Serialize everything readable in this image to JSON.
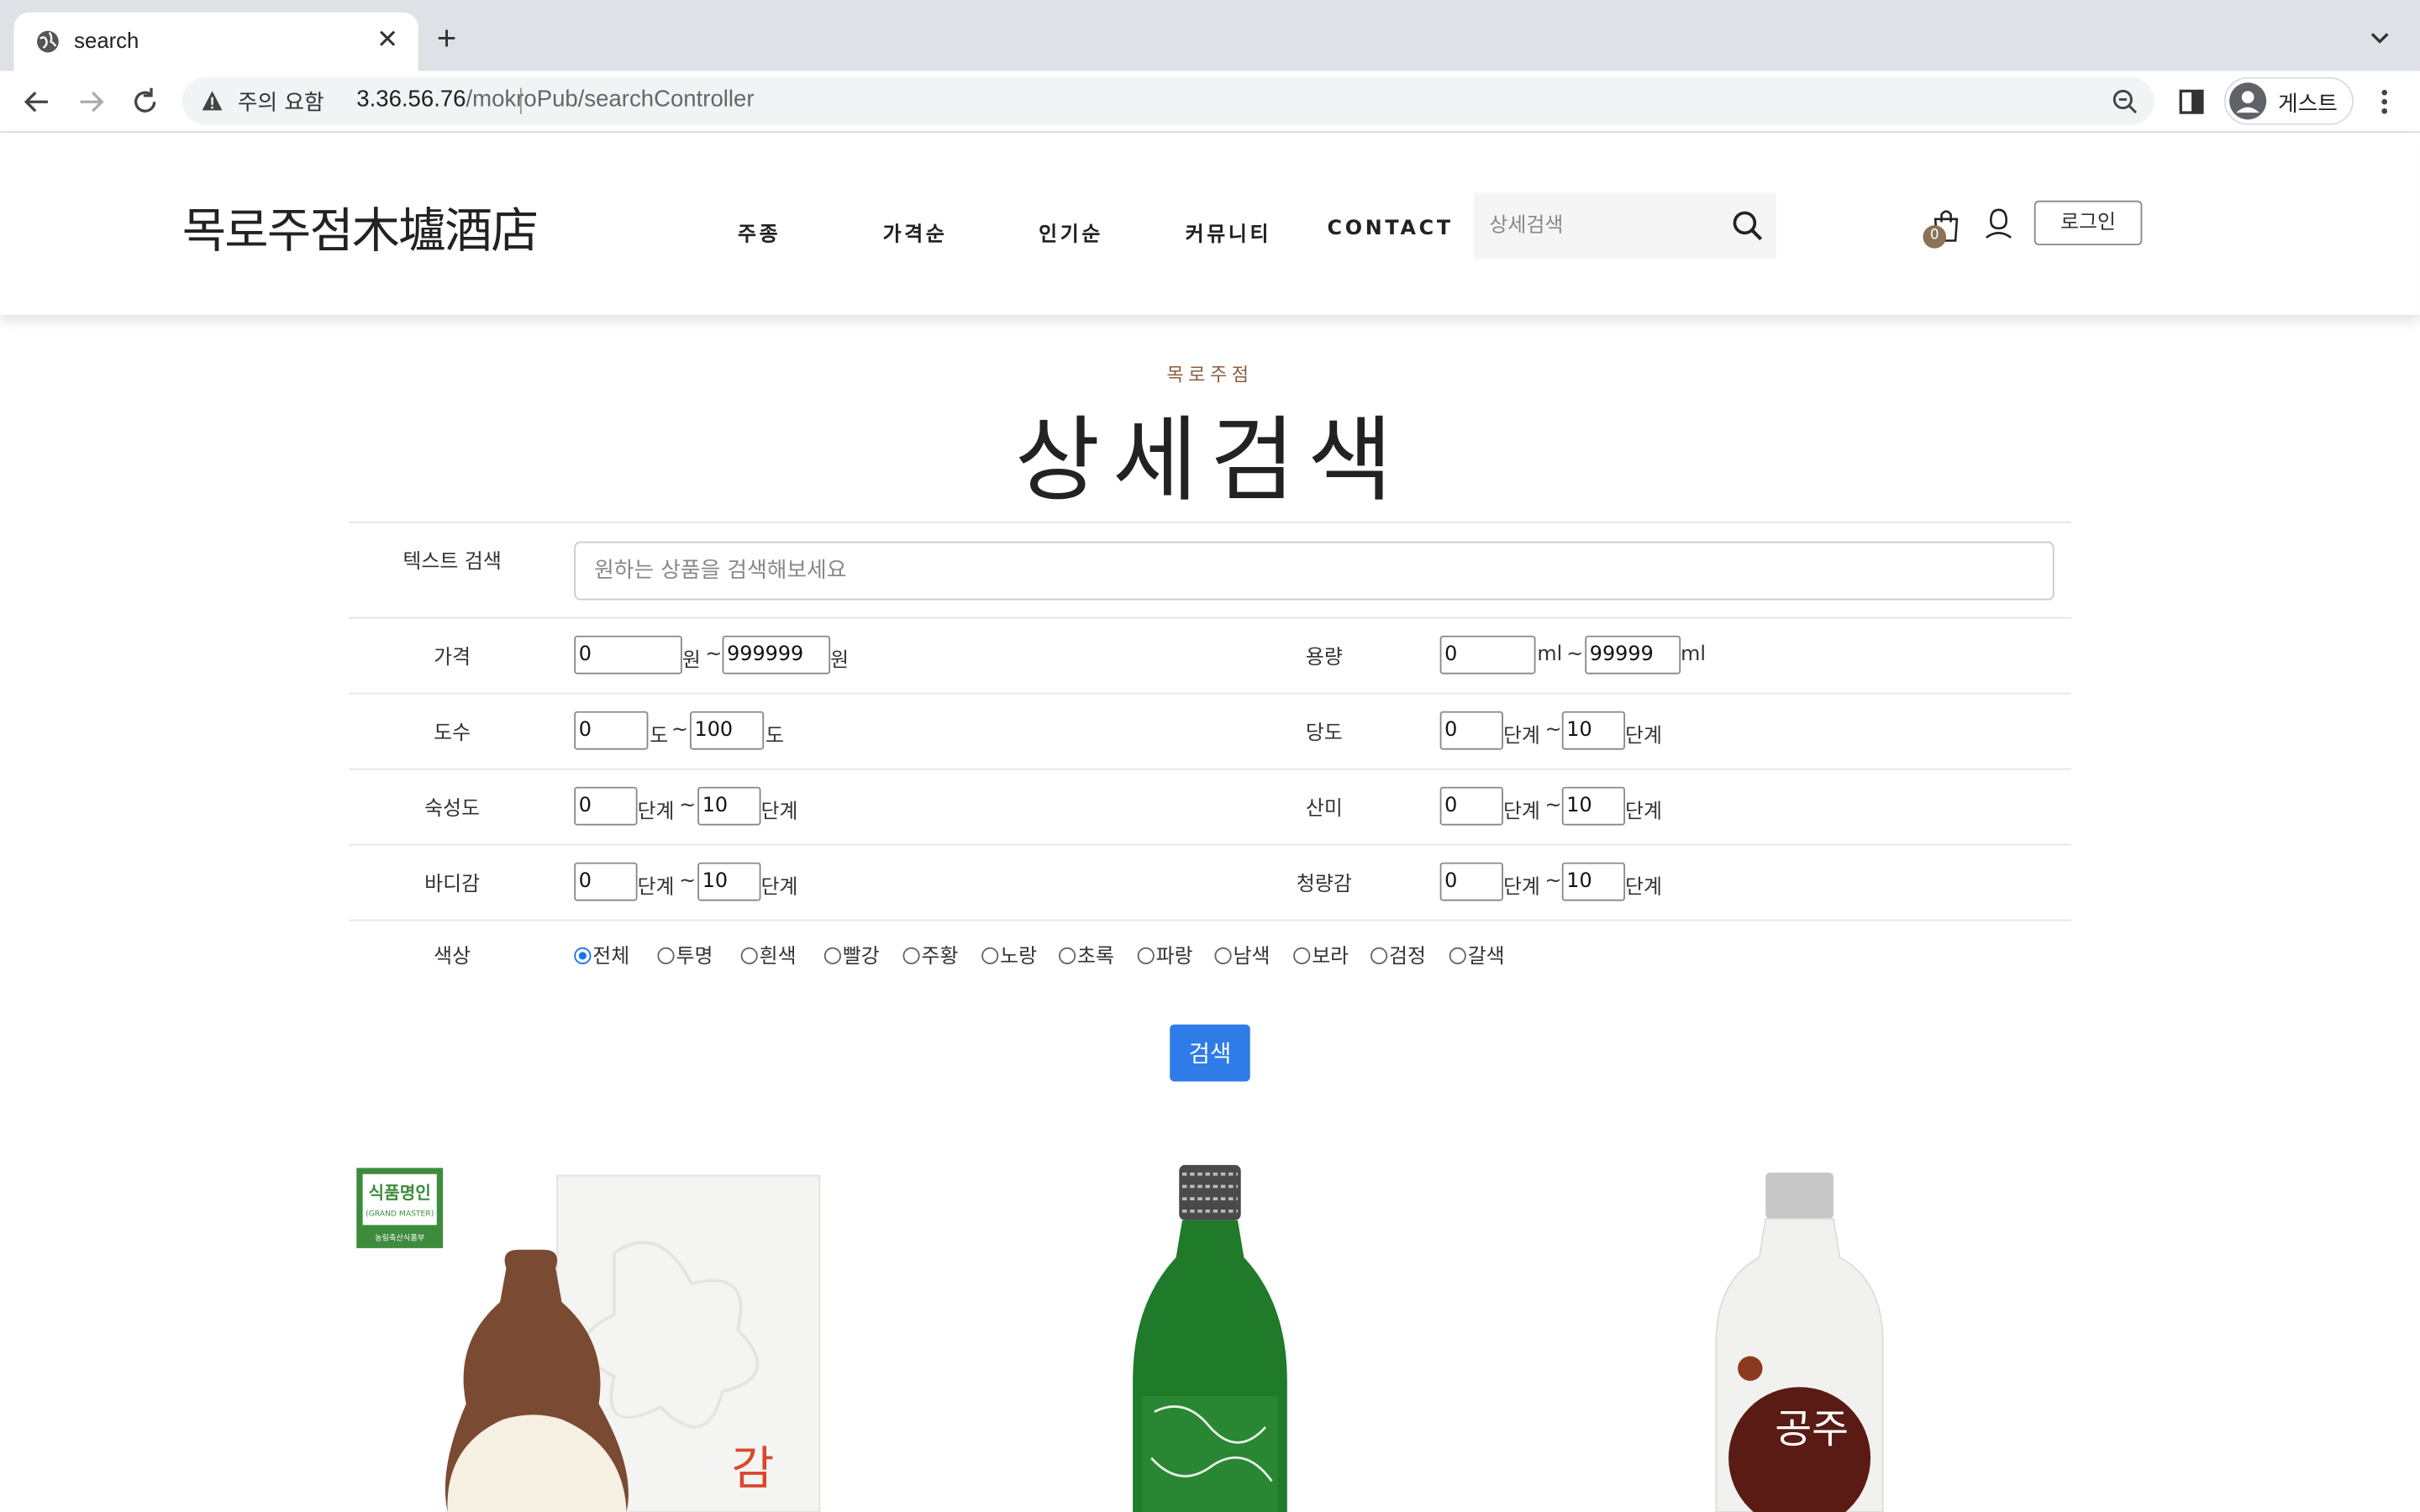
{
  "browser": {
    "tab_title": "search",
    "warning_text": "주의 요함",
    "url_host": "3.36.56.76",
    "url_path": "/mokroPub/searchController",
    "profile_name": "게스트"
  },
  "header": {
    "logo": "목로주점木壚酒店",
    "nav": [
      "주종",
      "가격순",
      "인기순",
      "커뮤니티",
      "CONTACT"
    ],
    "search_placeholder": "상세검색",
    "cart_count": "0",
    "login_label": "로그인"
  },
  "page": {
    "subtitle": "목로주점",
    "title": "상세검색"
  },
  "form": {
    "text_search": {
      "label": "텍스트 검색",
      "placeholder": "원하는 상품을 검색해보세요"
    },
    "price": {
      "label": "가격",
      "min": "0",
      "max": "999999",
      "unit": "원",
      "sep": "~"
    },
    "volume": {
      "label": "용량",
      "min": "0",
      "max": "99999",
      "unit": "ml",
      "sep": "~"
    },
    "abv": {
      "label": "도수",
      "min": "0",
      "max": "100",
      "unit": "도",
      "sep": "~"
    },
    "sweetness": {
      "label": "당도",
      "min": "0",
      "max": "10",
      "unit": "단계",
      "sep": "~"
    },
    "aging": {
      "label": "숙성도",
      "min": "0",
      "max": "10",
      "unit": "단계",
      "sep": "~"
    },
    "acidity": {
      "label": "산미",
      "min": "0",
      "max": "10",
      "unit": "단계",
      "sep": "~"
    },
    "body": {
      "label": "바디감",
      "min": "0",
      "max": "10",
      "unit": "단계",
      "sep": "~"
    },
    "freshness": {
      "label": "청량감",
      "min": "0",
      "max": "10",
      "unit": "단계",
      "sep": "~"
    },
    "color": {
      "label": "색상",
      "options": [
        "전체",
        "투명",
        "흰색",
        "빨강",
        "주황",
        "노랑",
        "초록",
        "파랑",
        "남색",
        "보라",
        "검정",
        "갈색"
      ],
      "selected": "전체"
    },
    "submit_label": "검색"
  },
  "products": {
    "p1": {
      "badge_title": "식품명인",
      "badge_sub": "(GRAND MASTER)",
      "badge_ministry": "농림축산식품부",
      "box_text": "감"
    },
    "p3": {
      "label_text": "공주"
    }
  },
  "colors": {
    "accent": "#2f7be8",
    "brand_brown": "#8b5e3c",
    "badge_green": "#3d8b3d"
  }
}
